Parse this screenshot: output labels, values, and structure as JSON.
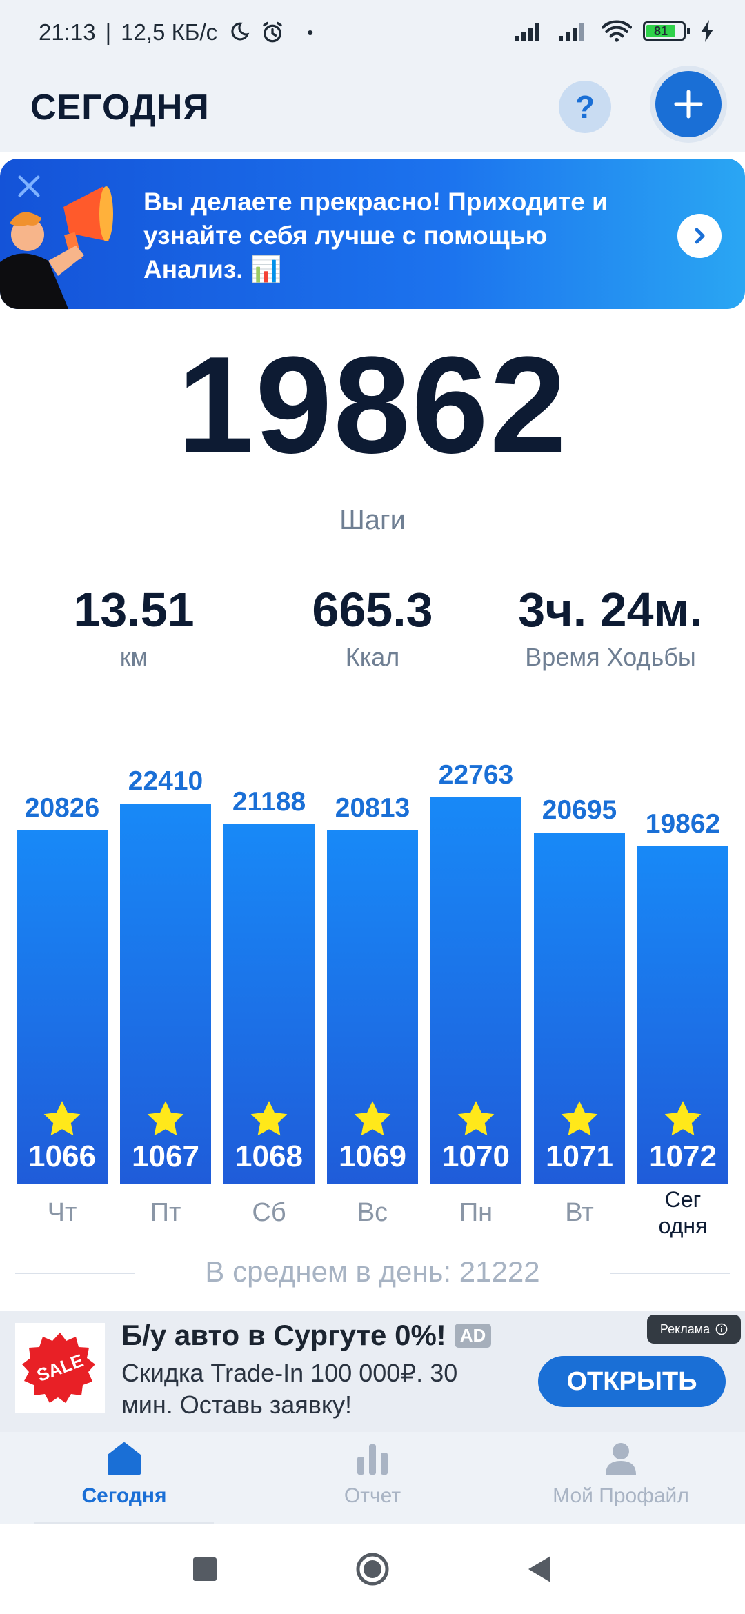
{
  "status_bar": {
    "time": "21:13",
    "network_speed": "12,5 КБ/с",
    "battery": "81"
  },
  "header": {
    "title": "СЕГОДНЯ",
    "help_label": "?"
  },
  "banner": {
    "text": "Вы делаете прекрасно! Приходите и узнайте себя лучше с помощью Анализ. 📊"
  },
  "summary": {
    "steps": "19862",
    "steps_label": "Шаги",
    "distance": "13.51",
    "distance_unit": "км",
    "calories": "665.3",
    "calories_unit": "Ккал",
    "walk_time": "3ч. 24м.",
    "walk_time_label": "Время Ходьбы"
  },
  "chart_data": {
    "type": "bar",
    "categories": [
      "Чт",
      "Пт",
      "Сб",
      "Вс",
      "Пн",
      "Вт",
      "Сег одня"
    ],
    "values": [
      20826,
      22410,
      21188,
      20813,
      22763,
      20695,
      19862
    ],
    "data_labels": [
      "20826",
      "22410",
      "21188",
      "20813",
      "22763",
      "20695",
      "19862"
    ],
    "streak_labels": [
      "1066",
      "1067",
      "1068",
      "1069",
      "1070",
      "1071",
      "1072"
    ],
    "title": "",
    "xlabel": "",
    "ylabel": "",
    "bar_color": "#1a6fd6",
    "value_color": "#1a6fd6",
    "star_color": "#ffe81a"
  },
  "chart_days": {
    "d0": "Чт",
    "d1": "Пт",
    "d2": "Сб",
    "d3": "Вс",
    "d4": "Пн",
    "d5": "Вт",
    "today_line1": "Сег",
    "today_line2": "одня"
  },
  "average": {
    "text": "В среднем в день: 21222"
  },
  "ad": {
    "title": "Б/у авто в Сургуте 0%!",
    "badge": "AD",
    "description": "Скидка Trade-In 100 000₽. 30 мин. Оставь заявку!",
    "cta": "ОТКРЫТЬ",
    "ad_label": "Реклама",
    "image_text": "SALE"
  },
  "bottom_nav": {
    "today": "Сегодня",
    "report": "Отчет",
    "profile": "Мой Профайл"
  },
  "colors": {
    "accent": "#1a6fd6",
    "background": "#eef2f7",
    "text_dark": "#0d1b33",
    "muted": "#6f7f93"
  }
}
